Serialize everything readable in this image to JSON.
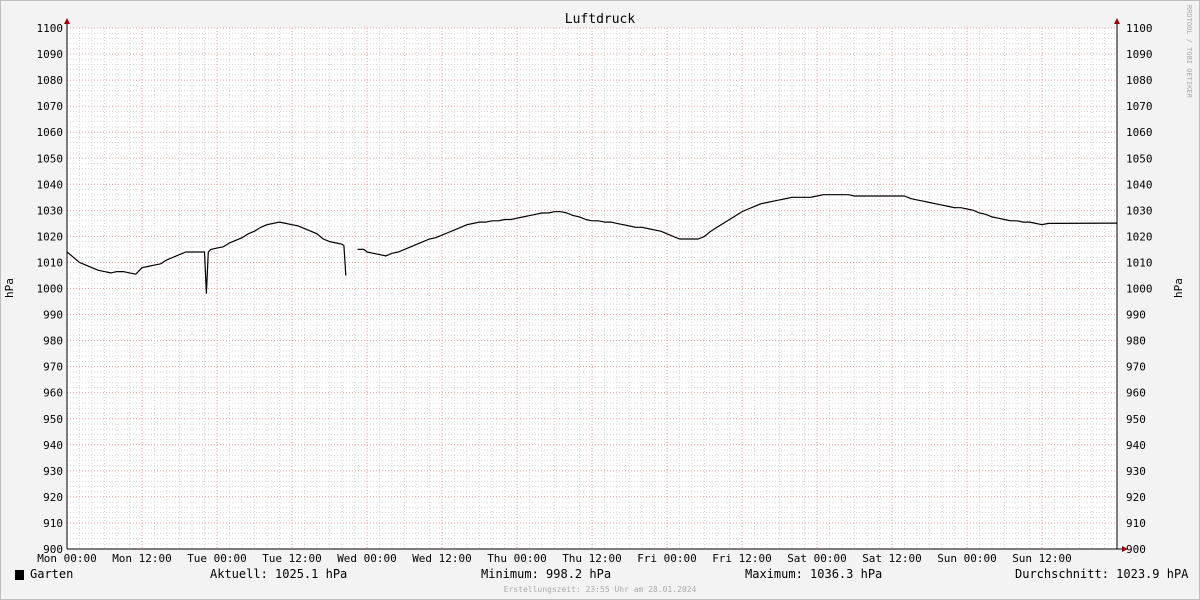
{
  "chart_data": {
    "type": "line",
    "title": "Luftdruck",
    "ylabel": "hPa",
    "ylim": [
      900,
      1100
    ],
    "y_ticks": [
      900,
      910,
      920,
      930,
      940,
      950,
      960,
      970,
      980,
      990,
      1000,
      1010,
      1020,
      1030,
      1040,
      1050,
      1060,
      1070,
      1080,
      1090,
      1100
    ],
    "xlim_hours": [
      0,
      168
    ],
    "x_tick_labels": [
      "Mon 00:00",
      "Mon 12:00",
      "Tue 00:00",
      "Tue 12:00",
      "Wed 00:00",
      "Wed 12:00",
      "Thu 00:00",
      "Thu 12:00",
      "Fri 00:00",
      "Fri 12:00",
      "Sat 00:00",
      "Sat 12:00",
      "Sun 00:00",
      "Sun 12:00"
    ],
    "grid": true,
    "series": [
      {
        "name": "Garten",
        "color": "#000000",
        "segments": [
          [
            [
              0,
              1014
            ],
            [
              1,
              1012
            ],
            [
              2,
              1010
            ],
            [
              3,
              1009
            ],
            [
              4,
              1008
            ],
            [
              5,
              1007
            ],
            [
              6,
              1006.5
            ],
            [
              7,
              1006
            ],
            [
              8,
              1006.5
            ],
            [
              9,
              1006.5
            ],
            [
              10,
              1006
            ],
            [
              11,
              1005.5
            ],
            [
              12,
              1008
            ],
            [
              13,
              1008.5
            ],
            [
              14,
              1009
            ],
            [
              15,
              1009.5
            ],
            [
              16,
              1011
            ],
            [
              17,
              1012
            ],
            [
              18,
              1013
            ],
            [
              19,
              1014
            ],
            [
              20,
              1014
            ],
            [
              21,
              1014
            ],
            [
              22,
              1014
            ],
            [
              22.3,
              998.2
            ],
            [
              22.6,
              1014
            ],
            [
              23,
              1015
            ],
            [
              24,
              1015.5
            ],
            [
              25,
              1016
            ],
            [
              26,
              1017.5
            ],
            [
              27,
              1018.5
            ],
            [
              28,
              1019.5
            ],
            [
              29,
              1021
            ],
            [
              30,
              1022
            ],
            [
              31,
              1023.5
            ],
            [
              32,
              1024.5
            ],
            [
              33,
              1025
            ],
            [
              34,
              1025.5
            ],
            [
              35,
              1025
            ],
            [
              36,
              1024.5
            ],
            [
              37,
              1024
            ],
            [
              38,
              1023
            ],
            [
              39,
              1022
            ],
            [
              40,
              1021
            ],
            [
              41,
              1019
            ],
            [
              42,
              1018
            ],
            [
              43,
              1017.5
            ],
            [
              44,
              1017
            ],
            [
              44.3,
              1016.5
            ],
            [
              44.6,
              1005
            ]
          ],
          [
            [
              46.5,
              1015
            ],
            [
              47.5,
              1015
            ],
            [
              48,
              1014
            ],
            [
              49,
              1013.5
            ],
            [
              50,
              1013
            ],
            [
              51,
              1012.5
            ],
            [
              52,
              1013.5
            ],
            [
              53,
              1014
            ],
            [
              54,
              1015
            ],
            [
              55,
              1016
            ],
            [
              56,
              1017
            ],
            [
              57,
              1018
            ],
            [
              58,
              1019
            ],
            [
              59,
              1019.5
            ],
            [
              60,
              1020.5
            ],
            [
              61,
              1021.5
            ],
            [
              62,
              1022.5
            ],
            [
              63,
              1023.5
            ],
            [
              64,
              1024.5
            ],
            [
              65,
              1025
            ],
            [
              66,
              1025.5
            ],
            [
              67,
              1025.5
            ],
            [
              68,
              1026
            ],
            [
              69,
              1026
            ],
            [
              70,
              1026.5
            ],
            [
              71,
              1026.5
            ],
            [
              72,
              1027
            ],
            [
              73,
              1027.5
            ],
            [
              74,
              1028
            ],
            [
              75,
              1028.5
            ],
            [
              76,
              1029
            ],
            [
              77,
              1029
            ],
            [
              78,
              1029.5
            ],
            [
              79,
              1029.5
            ],
            [
              80,
              1029
            ],
            [
              81,
              1028
            ],
            [
              82,
              1027.5
            ],
            [
              83,
              1026.5
            ],
            [
              84,
              1026
            ],
            [
              85,
              1026
            ],
            [
              86,
              1025.5
            ],
            [
              87,
              1025.5
            ],
            [
              88,
              1025
            ],
            [
              89,
              1024.5
            ],
            [
              90,
              1024
            ],
            [
              91,
              1023.5
            ],
            [
              92,
              1023.5
            ],
            [
              93,
              1023
            ],
            [
              94,
              1022.5
            ],
            [
              95,
              1022
            ],
            [
              96,
              1021
            ],
            [
              97,
              1020
            ],
            [
              98,
              1019
            ],
            [
              99,
              1019
            ],
            [
              100,
              1019
            ],
            [
              101,
              1019
            ],
            [
              102,
              1020
            ],
            [
              103,
              1022
            ],
            [
              104,
              1023.5
            ],
            [
              105,
              1025
            ],
            [
              106,
              1026.5
            ],
            [
              107,
              1028
            ],
            [
              108,
              1029.5
            ],
            [
              109,
              1030.5
            ],
            [
              110,
              1031.5
            ],
            [
              111,
              1032.5
            ],
            [
              112,
              1033
            ],
            [
              113,
              1033.5
            ],
            [
              114,
              1034
            ],
            [
              115,
              1034.5
            ],
            [
              116,
              1035
            ],
            [
              117,
              1035
            ],
            [
              118,
              1035
            ],
            [
              119,
              1035
            ],
            [
              120,
              1035.5
            ],
            [
              121,
              1036
            ],
            [
              122,
              1036
            ],
            [
              123,
              1036
            ],
            [
              124,
              1036
            ],
            [
              125,
              1036
            ],
            [
              126,
              1035.5
            ],
            [
              127,
              1035.5
            ],
            [
              128,
              1035.5
            ],
            [
              129,
              1035.5
            ],
            [
              130,
              1035.5
            ],
            [
              131,
              1035.5
            ],
            [
              132,
              1035.5
            ],
            [
              133,
              1035.5
            ],
            [
              134,
              1035.5
            ],
            [
              135,
              1034.5
            ],
            [
              136,
              1034
            ],
            [
              137,
              1033.5
            ],
            [
              138,
              1033
            ],
            [
              139,
              1032.5
            ],
            [
              140,
              1032
            ],
            [
              141,
              1031.5
            ],
            [
              142,
              1031
            ],
            [
              143,
              1031
            ],
            [
              144,
              1030.5
            ],
            [
              145,
              1030
            ],
            [
              146,
              1029
            ],
            [
              147,
              1028.5
            ],
            [
              148,
              1027.5
            ],
            [
              149,
              1027
            ],
            [
              150,
              1026.5
            ],
            [
              151,
              1026
            ],
            [
              152,
              1026
            ],
            [
              153,
              1025.5
            ],
            [
              154,
              1025.5
            ],
            [
              155,
              1025
            ],
            [
              156,
              1024.5
            ],
            [
              157,
              1025
            ],
            [
              158,
              1025
            ],
            [
              168,
              1025.1
            ]
          ]
        ]
      }
    ]
  },
  "watermark": "RRDTOOL / TOBI OETIKER",
  "legend": {
    "series_label": "Garten",
    "swatch_color": "#000000",
    "current": "Aktuell: 1025.1 hPa",
    "minimum": "Minimum: 998.2 hPa",
    "maximum": "Maximum: 1036.3 hPa",
    "average": "Durchschnitt: 1023.9 hPA"
  },
  "timestamp": "Erstellungszeit: 23:55 Uhr am 28.01.2024",
  "colors": {
    "background": "#f3f3f3",
    "plot_background": "#ffffff",
    "major_grid": "#e8a0a0",
    "minor_grid": "#d8d8d8",
    "axis_arrow": "#a00000",
    "line": "#000000"
  }
}
